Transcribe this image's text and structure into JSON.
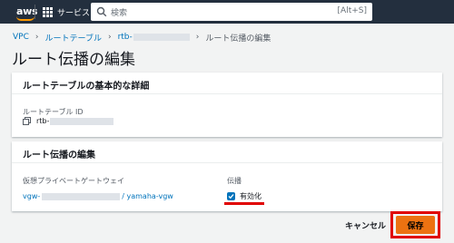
{
  "nav": {
    "logo_text": "aws",
    "services_label": "サービス",
    "search_placeholder": "検索",
    "search_shortcut": "[Alt+S]"
  },
  "breadcrumb": {
    "items": [
      "VPC",
      "ルートテーブル",
      "rtb-"
    ],
    "current": "ルート伝播の編集"
  },
  "page_title": "ルート伝播の編集",
  "panel_basic": {
    "title": "ルートテーブルの基本的な詳細",
    "route_table_id_label": "ルートテーブル ID",
    "route_table_id_value": "rtb-"
  },
  "panel_propagation": {
    "title": "ルート伝播の編集",
    "vgw_header": "仮想プライベートゲートウェイ",
    "propagation_header": "伝播",
    "vgw_prefix": "vgw-",
    "vgw_suffix": "/ yamaha-vgw",
    "checkbox_label": "有効化",
    "checkbox_checked": true
  },
  "actions": {
    "cancel": "キャンセル",
    "save": "保存"
  },
  "colors": {
    "nav_bg": "#232f3e",
    "link": "#0073bb",
    "primary": "#ec7211",
    "highlight": "#e00000"
  }
}
